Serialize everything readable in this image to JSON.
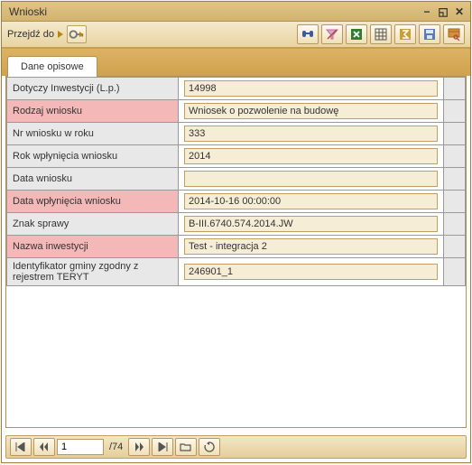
{
  "window": {
    "title": "Wnioski"
  },
  "toolbar": {
    "nav_label": "Przejdź do"
  },
  "tabs": {
    "active": "Dane opisowe"
  },
  "fields": [
    {
      "label": "Dotyczy Inwestycji (L.p.)",
      "value": "14998",
      "pink": false
    },
    {
      "label": "Rodzaj wniosku",
      "value": "Wniosek o pozwolenie na budowę",
      "pink": true
    },
    {
      "label": "Nr wniosku w roku",
      "value": "333",
      "pink": false
    },
    {
      "label": "Rok wpłynięcia wniosku",
      "value": "2014",
      "pink": false
    },
    {
      "label": "Data wniosku",
      "value": "",
      "pink": false
    },
    {
      "label": "Data wpłynięcia wniosku",
      "value": "2014-10-16 00:00:00",
      "pink": true
    },
    {
      "label": "Znak sprawy",
      "value": "B-III.6740.574.2014.JW",
      "pink": false
    },
    {
      "label": "Nazwa inwestycji",
      "value": "Test - integracja 2",
      "pink": true
    },
    {
      "label": "Identyfikator gminy zgodny z rejestrem TERYT",
      "value": "246901_1",
      "pink": false
    }
  ],
  "pager": {
    "current": "1",
    "total": "74"
  }
}
